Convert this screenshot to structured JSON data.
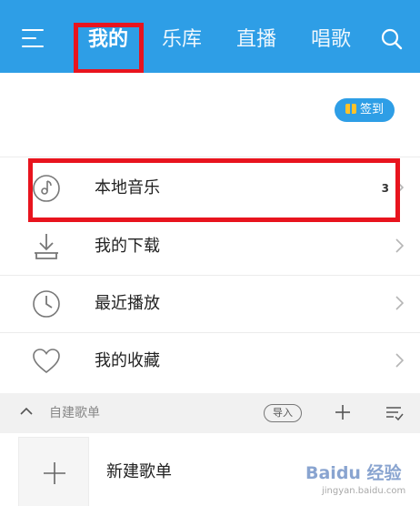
{
  "nav": {
    "tabs": [
      {
        "label": "我的",
        "active": true
      },
      {
        "label": "乐库",
        "active": false
      },
      {
        "label": "直播",
        "active": false
      },
      {
        "label": "唱歌",
        "active": false
      }
    ],
    "menu_icon": "hamburger-menu-icon",
    "search_icon": "search-icon"
  },
  "checkin": {
    "label": "签到",
    "icon": "gift-icon"
  },
  "menu": {
    "items": [
      {
        "label": "本地音乐",
        "count": "3",
        "icon": "disc-music-icon"
      },
      {
        "label": "我的下载",
        "count": "",
        "icon": "download-icon"
      },
      {
        "label": "最近播放",
        "count": "",
        "icon": "clock-icon"
      },
      {
        "label": "我的收藏",
        "count": "",
        "icon": "heart-icon"
      }
    ]
  },
  "playlists": {
    "section_title": "自建歌单",
    "import_label": "导入",
    "new_label": "新建歌单"
  },
  "watermark": {
    "text": "Baidu 经验",
    "sub": "jingyan.baidu.com"
  },
  "colors": {
    "accent": "#2e9ee6",
    "highlight": "#e8141e"
  }
}
